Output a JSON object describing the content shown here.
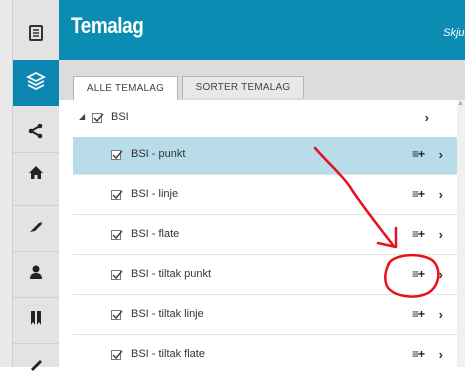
{
  "panel": {
    "title": "Temalag",
    "hide_label": "Skjul"
  },
  "tabs": [
    {
      "label": "ALLE TEMALAG",
      "active": true
    },
    {
      "label": "SORTER TEMALAG",
      "active": false
    }
  ],
  "layers": [
    {
      "label": "BSI",
      "group": true,
      "checked": true,
      "expanded": true
    },
    {
      "label": "BSI - punkt",
      "checked": true,
      "selected": true
    },
    {
      "label": "BSI - linje",
      "checked": true
    },
    {
      "label": "BSI - flate",
      "checked": true
    },
    {
      "label": "BSI - tiltak punkt",
      "checked": true
    },
    {
      "label": "BSI - tiltak linje",
      "checked": true
    },
    {
      "label": "BSI - tiltak flate",
      "checked": true
    }
  ],
  "glyphs": {
    "chevron": "›",
    "legend": "≡+",
    "expand": "◢"
  },
  "nav_icons": [
    "legend-icon",
    "layers-icon",
    "share-icon",
    "home-icon",
    "tag-icon",
    "person-icon",
    "bookmarks-icon",
    "pencil-icon"
  ],
  "annotation_color": "#e8101a",
  "accent_color": "#0a8cb3"
}
